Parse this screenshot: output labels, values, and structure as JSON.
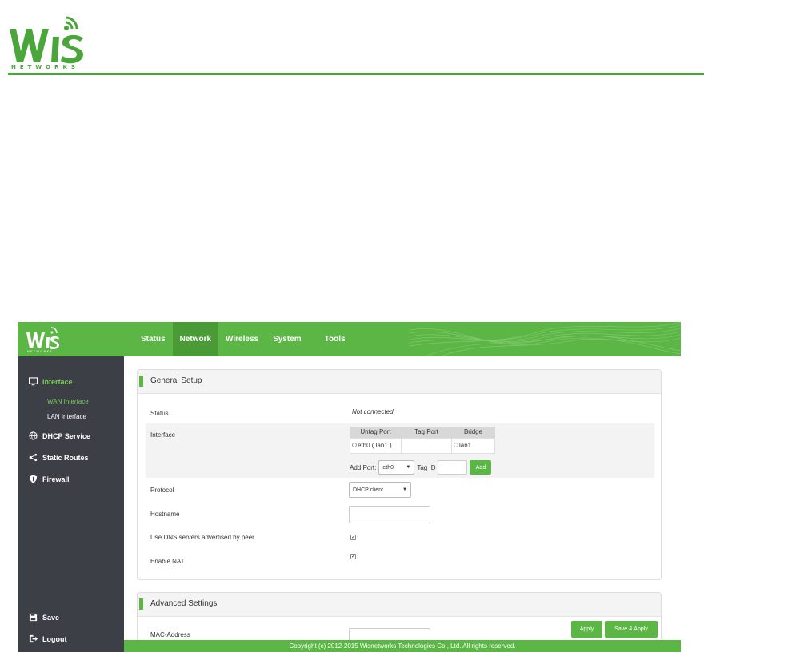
{
  "brand": {
    "logo_text": "WiS",
    "logo_sub": "NETWORKS",
    "accent": "#5cb646",
    "sidebar_bg": "#3c3f45"
  },
  "nav": {
    "items": [
      {
        "label": "Status"
      },
      {
        "label": "Network"
      },
      {
        "label": "Wireless"
      },
      {
        "label": "System"
      },
      {
        "label": "Tools"
      }
    ],
    "active": "Network"
  },
  "sidebar": {
    "interface": "Interface",
    "wan": "WAN Interface",
    "lan": "LAN Interface",
    "dhcp": "DHCP Service",
    "routes": "Static Routes",
    "firewall": "Firewall",
    "save": "Save",
    "logout": "Logout"
  },
  "general": {
    "title": "General Setup",
    "status_label": "Status",
    "status_value": "Not connected",
    "interface_label": "Interface",
    "ports": {
      "headers": [
        "Untag Port",
        "Tag Port",
        "Bridge"
      ],
      "untag": "eth0 ( lan1 )",
      "tag": "",
      "bridge": "lan1"
    },
    "add_port_label": "Add Port:",
    "add_port_value": "eth0",
    "tag_id_label": "Tag ID",
    "add_button": "Add",
    "protocol_label": "Protocol",
    "protocol_value": "DHCP client",
    "hostname_label": "Hostname",
    "dns_label": "Use DNS servers advertised by peer",
    "nat_label": "Enable NAT"
  },
  "advanced": {
    "title": "Advanced Settings",
    "mac_label": "MAC-Address",
    "apply": "Apply",
    "save_apply": "Save & Apply"
  },
  "footer": "Copyright (c) 2012-2015 Wisnetworks Technologies Co., Ltd. All rights reserved."
}
